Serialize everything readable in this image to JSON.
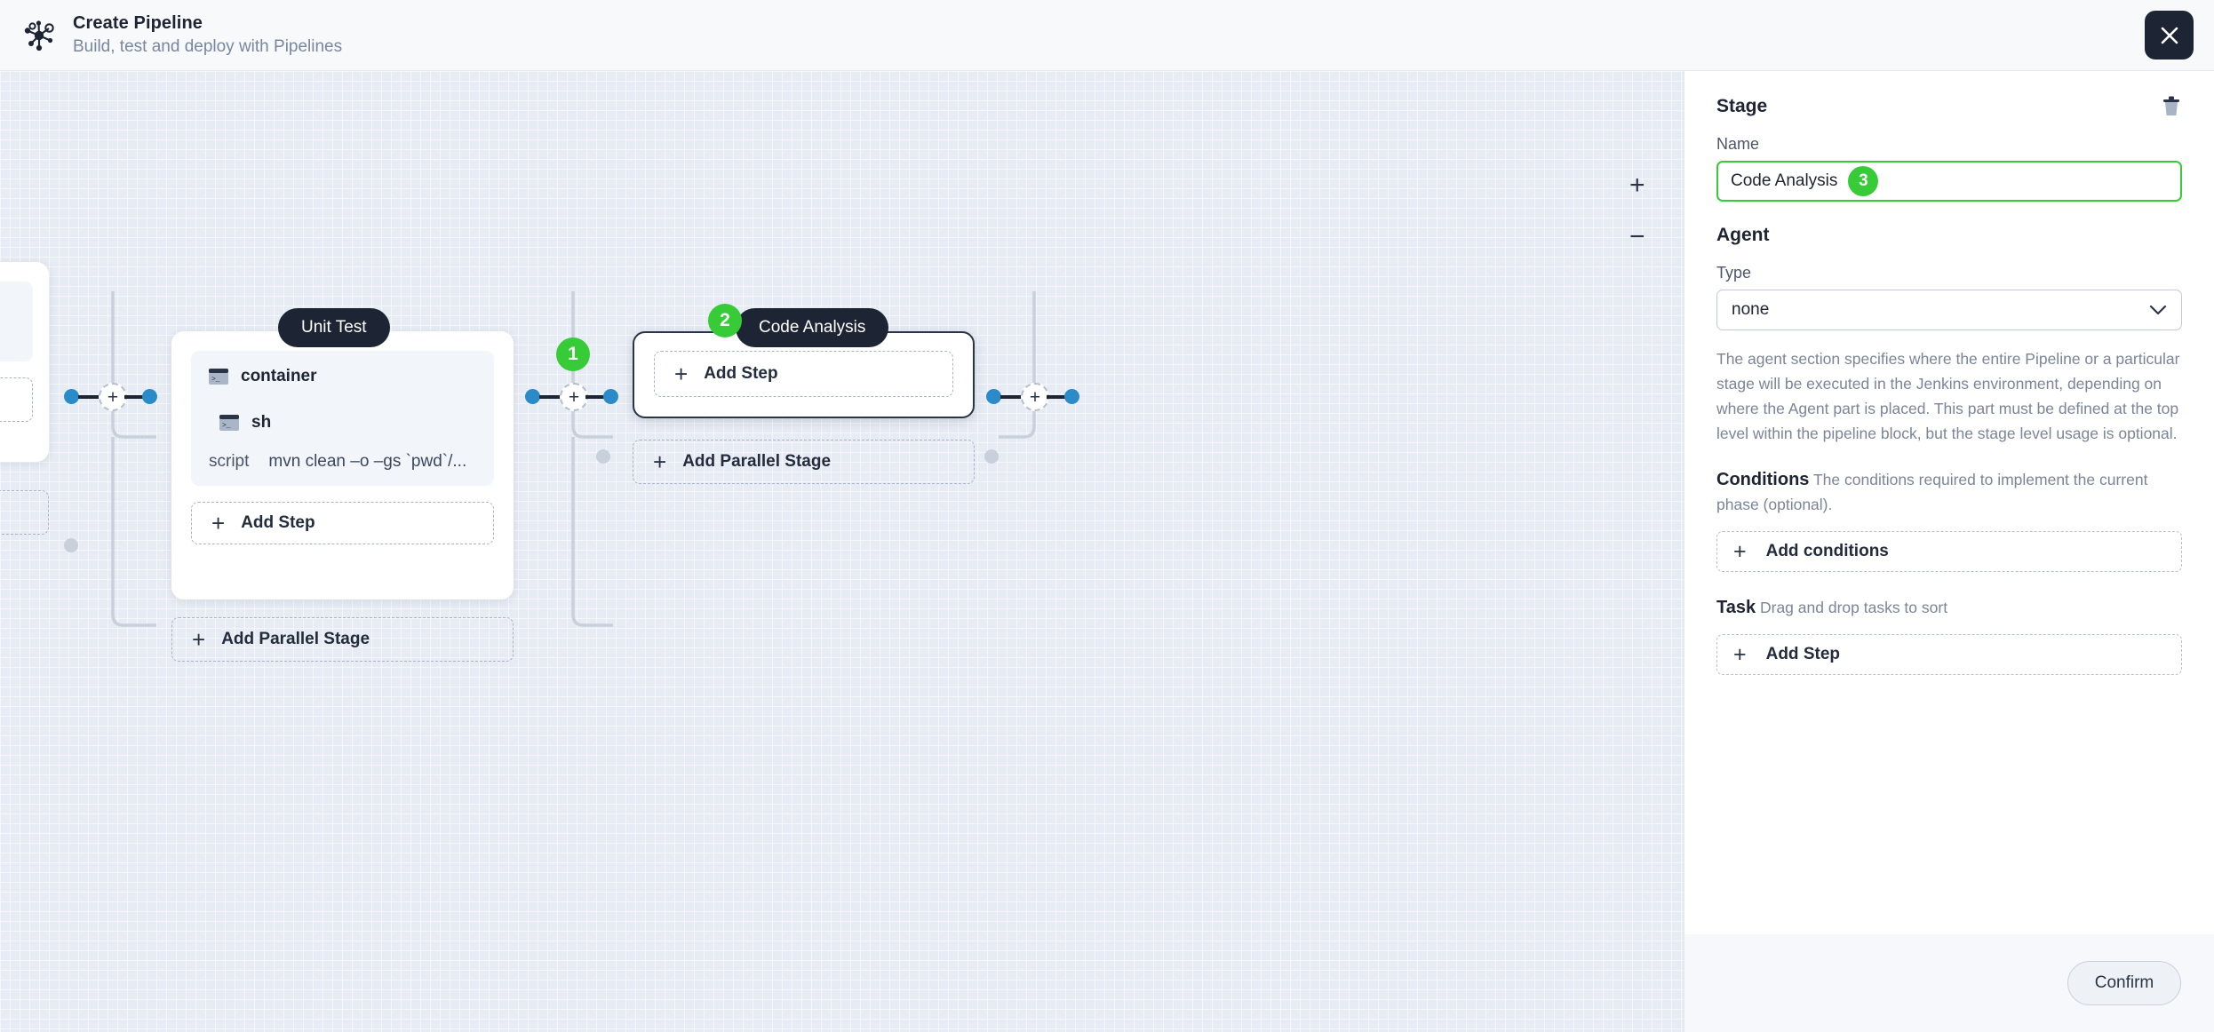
{
  "header": {
    "logo_icon": "pipeline-node-icon",
    "title": "Create Pipeline",
    "subtitle": "Build, test and deploy with Pipelines",
    "close_icon": "close-icon"
  },
  "canvas": {
    "zoom_in_label": "+",
    "zoom_out_label": "−",
    "stages": [
      {
        "name": "Unit Test",
        "selected": false,
        "steps": [
          {
            "icon": "terminal-icon",
            "label": "container"
          },
          {
            "icon": "terminal-icon",
            "label": "sh"
          }
        ],
        "script_key": "script",
        "script_value": "mvn clean –o –gs `pwd`/...",
        "add_step_label": "Add Step",
        "add_parallel_label": "Add Parallel Stage"
      },
      {
        "name": "Code Analysis",
        "selected": true,
        "steps": [],
        "add_step_label": "Add Step",
        "add_parallel_label": "Add Parallel Stage"
      }
    ],
    "badges": [
      {
        "number": "1",
        "target": "connector-plus-left"
      },
      {
        "number": "2",
        "target": "stage-label-code-analysis"
      }
    ],
    "connector_plus_label": "+"
  },
  "panel": {
    "section_title": "Stage",
    "delete_icon": "trash-icon",
    "name_label": "Name",
    "name_value": "Code Analysis",
    "name_badge": "3",
    "agent_title": "Agent",
    "type_label": "Type",
    "type_value": "none",
    "type_chevron_icon": "chevron-down-icon",
    "agent_help": "The agent section specifies where the entire Pipeline or a particular stage will be executed in the Jenkins environment, depending on where the Agent part is placed. This part must be defined at the top level within the pipeline block, but the stage level usage is optional.",
    "conditions_title": "Conditions",
    "conditions_help": "The conditions required to implement the current phase (optional).",
    "add_conditions_label": "Add conditions",
    "task_title": "Task",
    "task_help": "Drag and drop tasks to sort",
    "add_step_label": "Add Step",
    "confirm_label": "Confirm"
  },
  "colors": {
    "accent_green": "#37cc37",
    "connector_blue": "#2a8bc8",
    "dark": "#1d2433",
    "canvas_bg": "#e7ebf3"
  }
}
